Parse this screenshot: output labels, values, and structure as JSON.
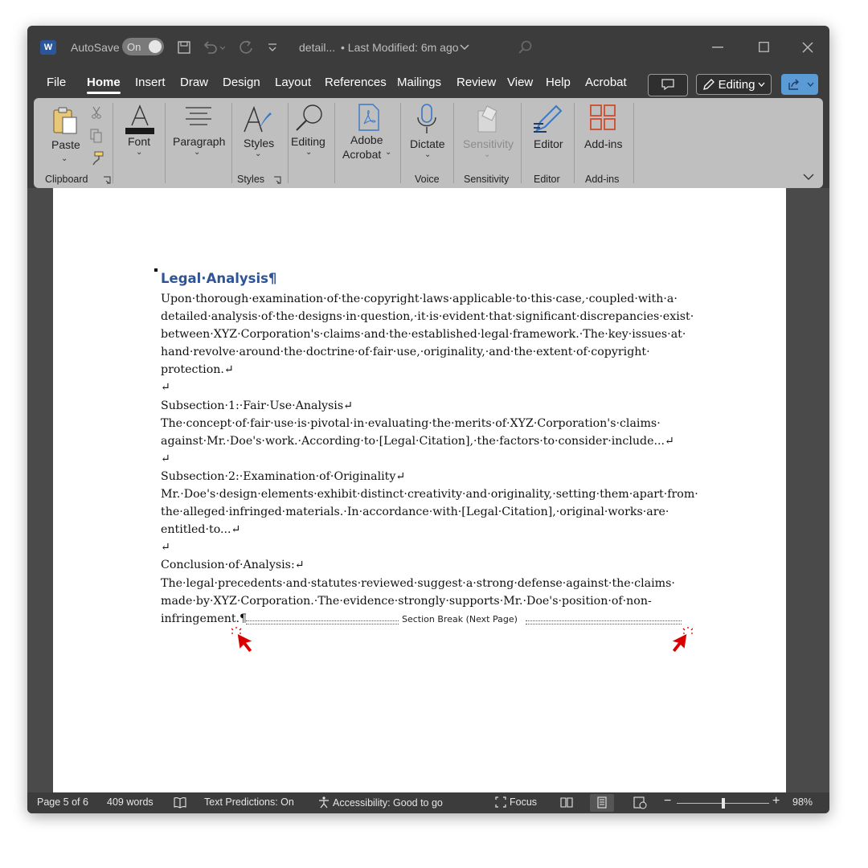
{
  "titlebar": {
    "autosave_label": "AutoSave",
    "autosave_state": "On",
    "doc_name": "detail...",
    "modified": "• Last Modified: 6m ago"
  },
  "menu": {
    "items": [
      "File",
      "Home",
      "Insert",
      "Draw",
      "Design",
      "Layout",
      "References",
      "Mailings",
      "Review",
      "View",
      "Help",
      "Acrobat"
    ],
    "active": "Home",
    "editing_label": "Editing"
  },
  "ribbon": {
    "paste": "Paste",
    "font": "Font",
    "paragraph": "Paragraph",
    "styles": "Styles",
    "editing": "Editing",
    "adobe_acrobat_1": "Adobe",
    "adobe_acrobat_2": "Acrobat",
    "dictate": "Dictate",
    "sensitivity": "Sensitivity",
    "editor": "Editor",
    "addins": "Add-ins",
    "groups": {
      "clipboard": "Clipboard",
      "styles": "Styles",
      "voice": "Voice",
      "sensitivity": "Sensitivity",
      "editor": "Editor",
      "addins": "Add-ins"
    }
  },
  "document": {
    "heading": "Legal·Analysis¶",
    "lines": [
      "Upon·thorough·examination·of·the·copyright·laws·applicable·to·this·case,·coupled·with·a·",
      "detailed·analysis·of·the·designs·in·question,·it·is·evident·that·significant·discrepancies·exist·",
      "between·XYZ·Corporation's·claims·and·the·established·legal·framework.·The·key·issues·at·",
      "hand·revolve·around·the·doctrine·of·fair·use,·originality,·and·the·extent·of·copyright·",
      "protection.↵",
      "↵",
      "Subsection·1:·Fair·Use·Analysis↵",
      "The·concept·of·fair·use·is·pivotal·in·evaluating·the·merits·of·XYZ·Corporation's·claims·",
      "against·Mr.·Doe's·work.·According·to·[Legal·Citation],·the·factors·to·consider·include...↵",
      "↵",
      "Subsection·2:·Examination·of·Originality↵",
      "Mr.·Doe's·design·elements·exhibit·distinct·creativity·and·originality,·setting·them·apart·from·",
      "the·alleged·infringed·materials.·In·accordance·with·[Legal·Citation],·original·works·are·",
      "entitled·to...↵",
      "↵",
      "Conclusion·of·Analysis:↵",
      "The·legal·precedents·and·statutes·reviewed·suggest·a·strong·defense·against·the·claims·",
      "made·by·XYZ·Corporation.·The·evidence·strongly·supports·Mr.·Doe's·position·of·non-",
      "infringement.¶"
    ],
    "section_break": "Section Break (Next Page)"
  },
  "status": {
    "page": "Page 5 of 6",
    "words": "409 words",
    "predictions": "Text Predictions: On",
    "accessibility": "Accessibility: Good to go",
    "focus": "Focus",
    "zoom": "98%",
    "zoom_level": 0.5
  },
  "colors": {
    "heading": "#2f5496",
    "cursor": "#d90000",
    "ribbon": "#bfbfbf"
  }
}
